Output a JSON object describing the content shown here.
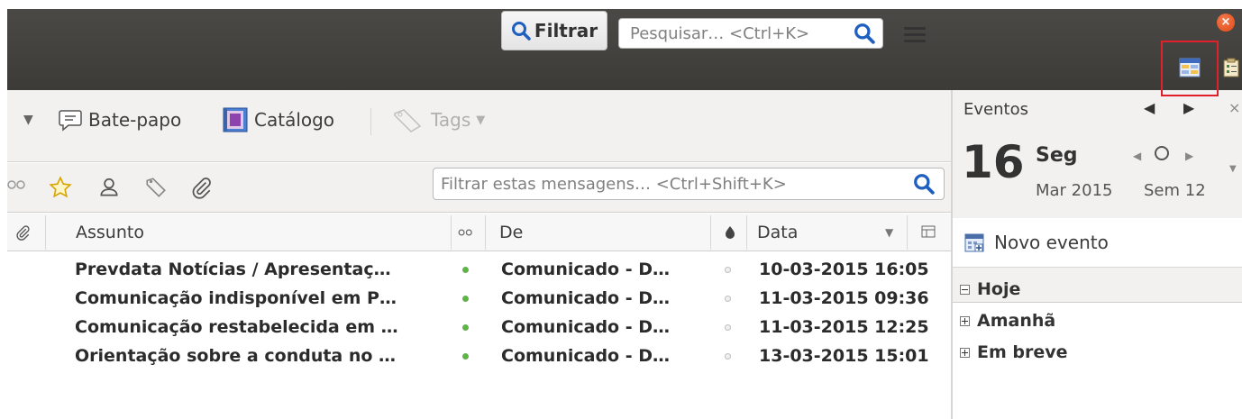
{
  "titlebar": {
    "close_icon": "close-icon",
    "highlight_color": "#e0202a",
    "icons": [
      "calendar-view-icon",
      "tasks-icon"
    ]
  },
  "toolbar": {
    "items": [
      {
        "label": "Bate-papo",
        "icon": "chat-icon"
      },
      {
        "label": "Catálogo",
        "icon": "address-book-icon"
      },
      {
        "label": "Tags",
        "icon": "tag-icon",
        "disabled": true
      },
      {
        "label": "Filtrar",
        "icon": "search-icon"
      }
    ],
    "search_placeholder": "Pesquisar… <Ctrl+K>",
    "menu_icon": "hamburger-menu-icon"
  },
  "quick_filter": {
    "icons": [
      "unread-icon",
      "star-icon",
      "contact-icon",
      "tag-icon",
      "attachment-icon"
    ],
    "placeholder": "Filtrar estas mensagens… <Ctrl+Shift+K>"
  },
  "columns": {
    "attachment": "attachment-icon",
    "subject": "Assunto",
    "thread": "thread-icon",
    "from": "De",
    "junk": "junk-icon",
    "date": "Data",
    "picker": "column-picker-icon"
  },
  "messages": [
    {
      "subject": "Prevdata Notícias / Apresentaç…",
      "from": "Comunicado - D…",
      "date": "10-03-2015 16:05"
    },
    {
      "subject": "Comunicação indisponível em P…",
      "from": "Comunicado - D…",
      "date": "11-03-2015 09:36"
    },
    {
      "subject": "Comunicação restabelecida em …",
      "from": "Comunicado - D…",
      "date": "11-03-2015 12:25"
    },
    {
      "subject": "Orientação sobre a conduta no …",
      "from": "Comunicado - D…",
      "date": "13-03-2015 15:01"
    }
  ],
  "events_pane": {
    "title": "Eventos",
    "day": "16",
    "weekday": "Seg",
    "month_year": "Mar 2015",
    "week": "Sem 12",
    "new_event": "Novo evento",
    "sections": [
      {
        "label": "Hoje",
        "expanded": true
      },
      {
        "label": "Amanhã",
        "expanded": false
      },
      {
        "label": "Em breve",
        "expanded": false
      }
    ]
  }
}
